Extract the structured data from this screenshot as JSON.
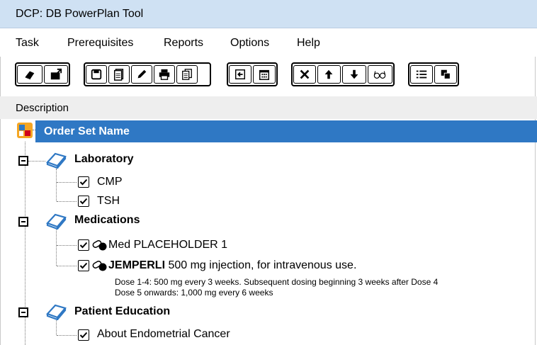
{
  "window": {
    "title": "DCP: DB PowerPlan Tool"
  },
  "menu": [
    "Task",
    "Prerequisites",
    "Reports",
    "Options",
    "Help"
  ],
  "toolbar": {
    "group1": [
      "open-book-icon",
      "import-folder-icon"
    ],
    "group2": [
      "save-icon",
      "document-icon",
      "edit-pencil-icon",
      "print-icon",
      "copy-pages-icon"
    ],
    "group3": [
      "exit-icon",
      "calendar-icon"
    ],
    "group4": [
      "delete-x-icon",
      "move-up-icon",
      "move-down-icon",
      "preview-glasses-icon"
    ],
    "group5": [
      "list-icon",
      "group-icon"
    ]
  },
  "header": {
    "description_label": "Description"
  },
  "order_set": {
    "name": "Order Set Name"
  },
  "tree": {
    "laboratory": {
      "label": "Laboratory",
      "items": [
        "CMP",
        "TSH"
      ]
    },
    "medications": {
      "label": "Medications",
      "item1": "Med PLACEHOLDER 1",
      "item2_name": "JEMPERLI",
      "item2_rest": " 500 mg injection, for intravenous use.",
      "item2_detail_1": "Dose 1-4: 500 mg every 3 weeks. Subsequent dosing beginning 3 weeks after Dose 4",
      "item2_detail_2": "Dose 5 onwards: 1,000 mg every 6 weeks"
    },
    "patient_education": {
      "label": "Patient Education",
      "items": [
        "About Endometrial Cancer"
      ]
    }
  },
  "colors": {
    "titlebar": "#cfe1f3",
    "orderbar": "#2f78c4",
    "book": "#2f78c4",
    "descbar": "#eeeeee"
  }
}
